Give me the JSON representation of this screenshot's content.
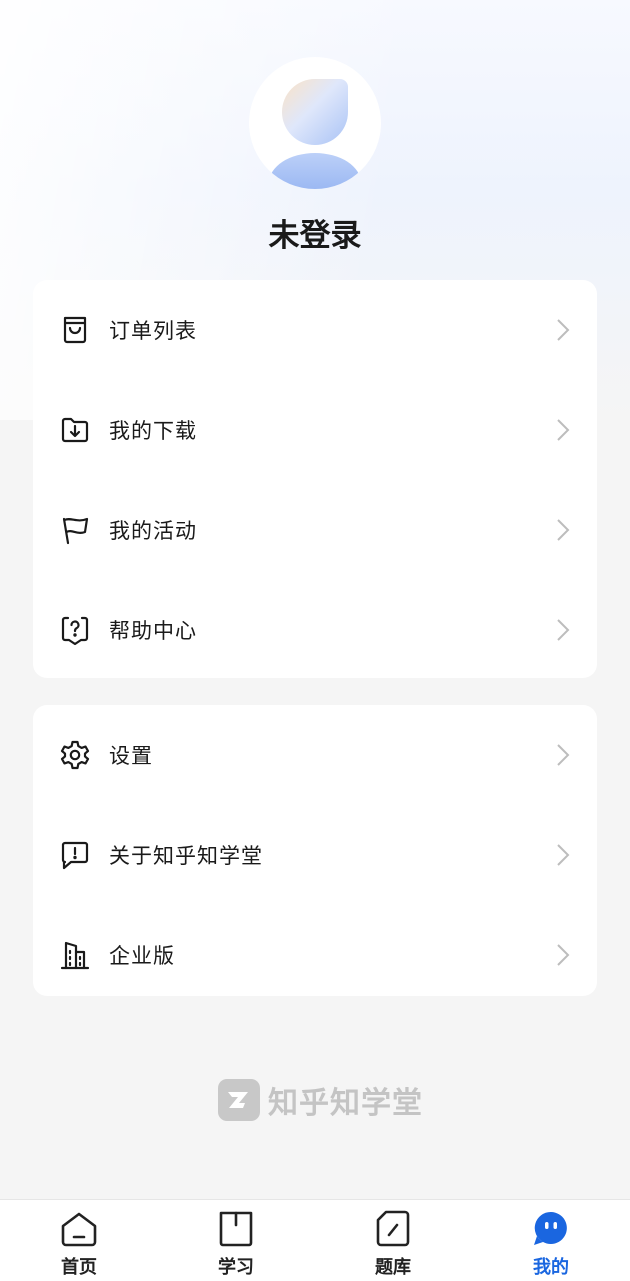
{
  "profile": {
    "username": "未登录"
  },
  "menu_group_1": [
    {
      "label": "订单列表",
      "icon": "shopping-bag-icon"
    },
    {
      "label": "我的下载",
      "icon": "download-folder-icon"
    },
    {
      "label": "我的活动",
      "icon": "flag-icon"
    },
    {
      "label": "帮助中心",
      "icon": "help-question-icon"
    }
  ],
  "menu_group_2": [
    {
      "label": "设置",
      "icon": "gear-icon"
    },
    {
      "label": "关于知乎知学堂",
      "icon": "info-message-icon"
    },
    {
      "label": "企业版",
      "icon": "building-icon"
    }
  ],
  "brand": {
    "name": "知乎知学堂"
  },
  "tabbar": {
    "tabs": [
      {
        "label": "首页",
        "icon": "home-icon",
        "active": false
      },
      {
        "label": "学习",
        "icon": "book-icon",
        "active": false
      },
      {
        "label": "题库",
        "icon": "edit-doc-icon",
        "active": false
      },
      {
        "label": "我的",
        "icon": "profile-face-icon",
        "active": true
      }
    ],
    "active_color": "#1a66e0"
  }
}
